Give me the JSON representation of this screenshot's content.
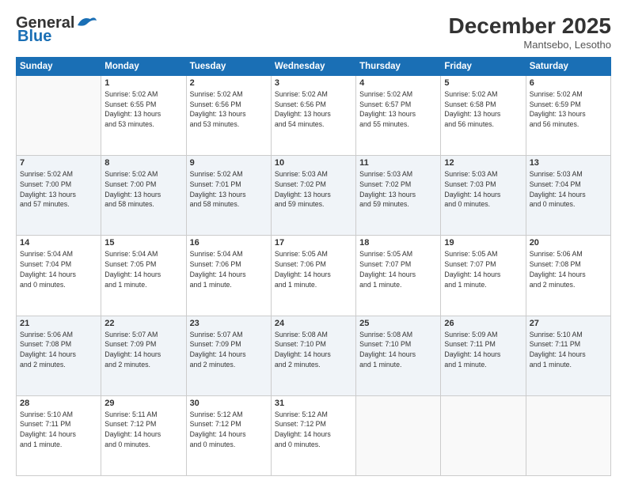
{
  "logo": {
    "line1": "General",
    "line2": "Blue"
  },
  "header": {
    "month": "December 2025",
    "location": "Mantsebo, Lesotho"
  },
  "weekdays": [
    "Sunday",
    "Monday",
    "Tuesday",
    "Wednesday",
    "Thursday",
    "Friday",
    "Saturday"
  ],
  "weeks": [
    [
      {
        "day": "",
        "info": ""
      },
      {
        "day": "1",
        "info": "Sunrise: 5:02 AM\nSunset: 6:55 PM\nDaylight: 13 hours\nand 53 minutes."
      },
      {
        "day": "2",
        "info": "Sunrise: 5:02 AM\nSunset: 6:56 PM\nDaylight: 13 hours\nand 53 minutes."
      },
      {
        "day": "3",
        "info": "Sunrise: 5:02 AM\nSunset: 6:56 PM\nDaylight: 13 hours\nand 54 minutes."
      },
      {
        "day": "4",
        "info": "Sunrise: 5:02 AM\nSunset: 6:57 PM\nDaylight: 13 hours\nand 55 minutes."
      },
      {
        "day": "5",
        "info": "Sunrise: 5:02 AM\nSunset: 6:58 PM\nDaylight: 13 hours\nand 56 minutes."
      },
      {
        "day": "6",
        "info": "Sunrise: 5:02 AM\nSunset: 6:59 PM\nDaylight: 13 hours\nand 56 minutes."
      }
    ],
    [
      {
        "day": "7",
        "info": "Sunrise: 5:02 AM\nSunset: 7:00 PM\nDaylight: 13 hours\nand 57 minutes."
      },
      {
        "day": "8",
        "info": "Sunrise: 5:02 AM\nSunset: 7:00 PM\nDaylight: 13 hours\nand 58 minutes."
      },
      {
        "day": "9",
        "info": "Sunrise: 5:02 AM\nSunset: 7:01 PM\nDaylight: 13 hours\nand 58 minutes."
      },
      {
        "day": "10",
        "info": "Sunrise: 5:03 AM\nSunset: 7:02 PM\nDaylight: 13 hours\nand 59 minutes."
      },
      {
        "day": "11",
        "info": "Sunrise: 5:03 AM\nSunset: 7:02 PM\nDaylight: 13 hours\nand 59 minutes."
      },
      {
        "day": "12",
        "info": "Sunrise: 5:03 AM\nSunset: 7:03 PM\nDaylight: 14 hours\nand 0 minutes."
      },
      {
        "day": "13",
        "info": "Sunrise: 5:03 AM\nSunset: 7:04 PM\nDaylight: 14 hours\nand 0 minutes."
      }
    ],
    [
      {
        "day": "14",
        "info": "Sunrise: 5:04 AM\nSunset: 7:04 PM\nDaylight: 14 hours\nand 0 minutes."
      },
      {
        "day": "15",
        "info": "Sunrise: 5:04 AM\nSunset: 7:05 PM\nDaylight: 14 hours\nand 1 minute."
      },
      {
        "day": "16",
        "info": "Sunrise: 5:04 AM\nSunset: 7:06 PM\nDaylight: 14 hours\nand 1 minute."
      },
      {
        "day": "17",
        "info": "Sunrise: 5:05 AM\nSunset: 7:06 PM\nDaylight: 14 hours\nand 1 minute."
      },
      {
        "day": "18",
        "info": "Sunrise: 5:05 AM\nSunset: 7:07 PM\nDaylight: 14 hours\nand 1 minute."
      },
      {
        "day": "19",
        "info": "Sunrise: 5:05 AM\nSunset: 7:07 PM\nDaylight: 14 hours\nand 1 minute."
      },
      {
        "day": "20",
        "info": "Sunrise: 5:06 AM\nSunset: 7:08 PM\nDaylight: 14 hours\nand 2 minutes."
      }
    ],
    [
      {
        "day": "21",
        "info": "Sunrise: 5:06 AM\nSunset: 7:08 PM\nDaylight: 14 hours\nand 2 minutes."
      },
      {
        "day": "22",
        "info": "Sunrise: 5:07 AM\nSunset: 7:09 PM\nDaylight: 14 hours\nand 2 minutes."
      },
      {
        "day": "23",
        "info": "Sunrise: 5:07 AM\nSunset: 7:09 PM\nDaylight: 14 hours\nand 2 minutes."
      },
      {
        "day": "24",
        "info": "Sunrise: 5:08 AM\nSunset: 7:10 PM\nDaylight: 14 hours\nand 2 minutes."
      },
      {
        "day": "25",
        "info": "Sunrise: 5:08 AM\nSunset: 7:10 PM\nDaylight: 14 hours\nand 1 minute."
      },
      {
        "day": "26",
        "info": "Sunrise: 5:09 AM\nSunset: 7:11 PM\nDaylight: 14 hours\nand 1 minute."
      },
      {
        "day": "27",
        "info": "Sunrise: 5:10 AM\nSunset: 7:11 PM\nDaylight: 14 hours\nand 1 minute."
      }
    ],
    [
      {
        "day": "28",
        "info": "Sunrise: 5:10 AM\nSunset: 7:11 PM\nDaylight: 14 hours\nand 1 minute."
      },
      {
        "day": "29",
        "info": "Sunrise: 5:11 AM\nSunset: 7:12 PM\nDaylight: 14 hours\nand 0 minutes."
      },
      {
        "day": "30",
        "info": "Sunrise: 5:12 AM\nSunset: 7:12 PM\nDaylight: 14 hours\nand 0 minutes."
      },
      {
        "day": "31",
        "info": "Sunrise: 5:12 AM\nSunset: 7:12 PM\nDaylight: 14 hours\nand 0 minutes."
      },
      {
        "day": "",
        "info": ""
      },
      {
        "day": "",
        "info": ""
      },
      {
        "day": "",
        "info": ""
      }
    ]
  ]
}
